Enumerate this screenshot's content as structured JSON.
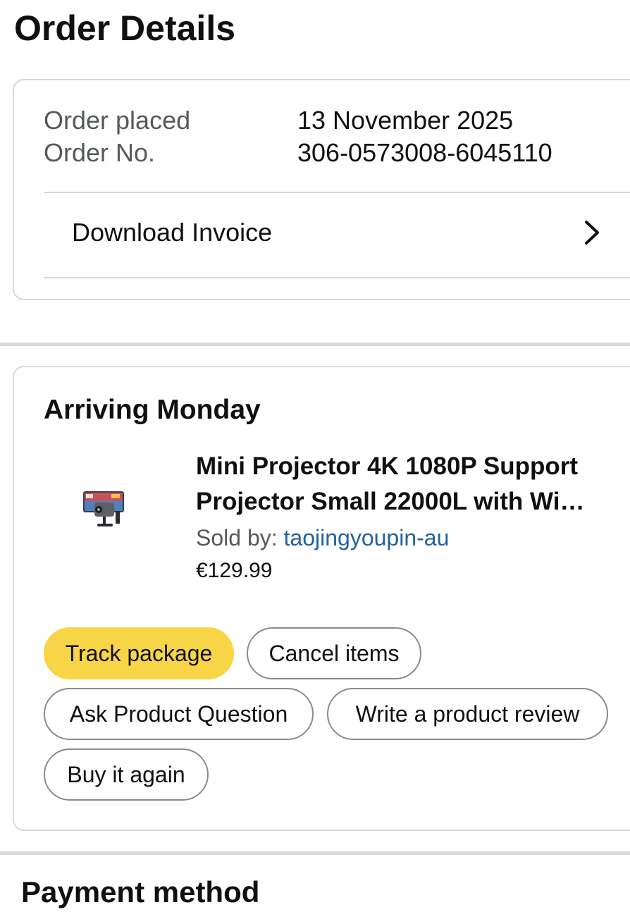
{
  "page": {
    "title": "Order Details"
  },
  "order": {
    "placed_label": "Order placed",
    "placed_value": "13 November 2025",
    "number_label": "Order No.",
    "number_value": "306-0573008-6045110",
    "invoice_label": "Download Invoice",
    "invoice_icon": "chevron-right-icon"
  },
  "shipment": {
    "status": "Arriving Monday",
    "product": {
      "title": "Mini Projector 4K 1080P Support\nProjector Small 22000L with Wi…",
      "sold_by_label": "Sold by: ",
      "seller": "taojingyoupin-au",
      "price": "€129.99",
      "thumbnail_icon": "projector-image"
    },
    "buttons": {
      "track": "Track package",
      "cancel": "Cancel items",
      "ask": "Ask Product Question",
      "review": "Write a product review",
      "buy_again": "Buy it again"
    }
  },
  "payment": {
    "title": "Payment method"
  },
  "colors": {
    "primary_button": "#f7d547",
    "link": "#2162a1",
    "muted_text": "#565959",
    "border": "#d5d9d9"
  }
}
